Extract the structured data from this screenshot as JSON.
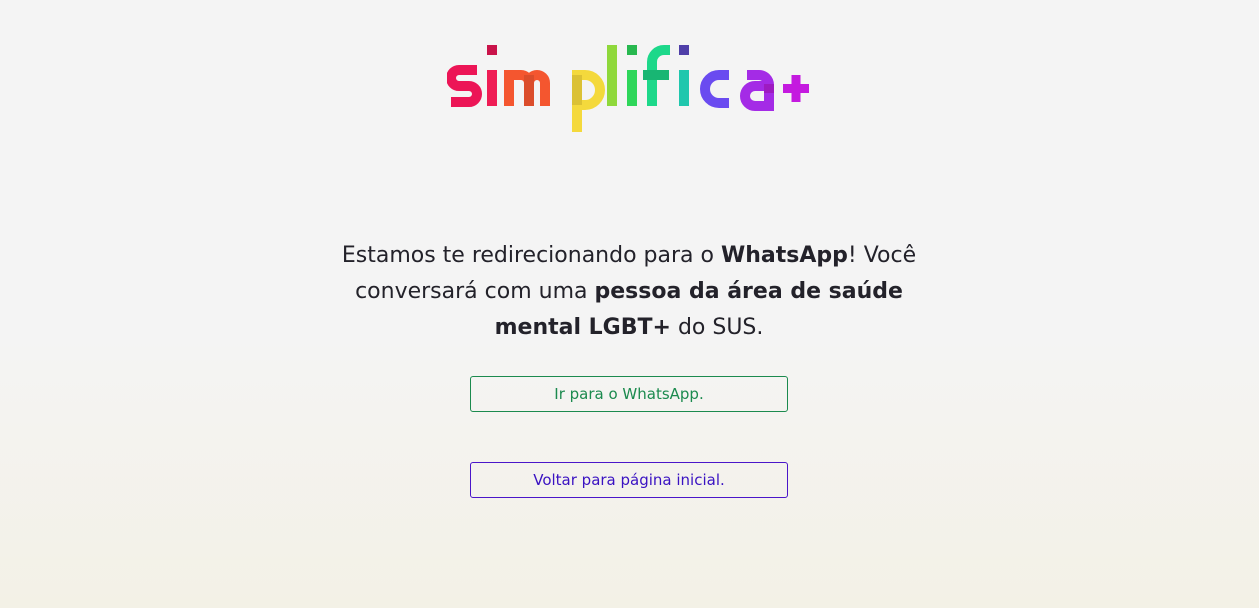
{
  "logo": {
    "text": "simplifica+",
    "colors": [
      "#ec1556",
      "#f2225e",
      "#f4562f",
      "#f5b82d",
      "#f4d93c",
      "#7fd93a",
      "#16d35e",
      "#20c7ad",
      "#6a4bf0",
      "#b623e0",
      "#c41adf"
    ]
  },
  "message": {
    "part1": "Estamos te redirecionando para o ",
    "bold1": "WhatsApp",
    "part2": "! Você conversará com uma ",
    "bold2": "pessoa da área de saúde mental LGBT+",
    "part3": " do SUS."
  },
  "buttons": {
    "whatsapp_label": "Ir para o WhatsApp.",
    "home_label": "Voltar para página inicial."
  },
  "colors": {
    "whatsapp": "#1b8a4e",
    "home": "#4a16c9"
  }
}
